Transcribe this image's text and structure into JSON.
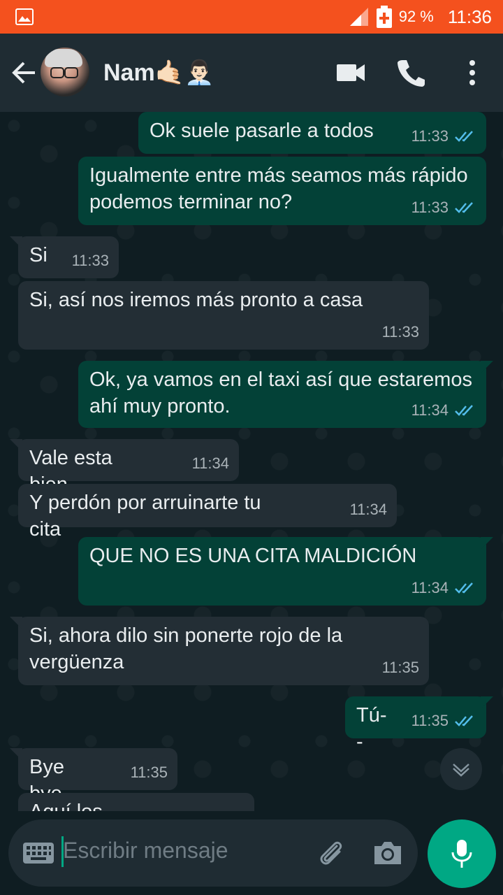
{
  "status": {
    "battery_pct": "92 %",
    "time": "11:36"
  },
  "header": {
    "name": "Nam🤙🏻👨🏻‍💼"
  },
  "messages": [
    {
      "dir": "out",
      "text": "Ok suele pasarle a todos",
      "time": "11:33"
    },
    {
      "dir": "out",
      "text": "Igualmente entre más seamos más rápido podemos terminar no?",
      "time": "11:33"
    },
    {
      "dir": "in",
      "text": "Si",
      "time": "11:33"
    },
    {
      "dir": "in",
      "text": "Si, así nos iremos más pronto a casa",
      "time": "11:33"
    },
    {
      "dir": "out",
      "text": "Ok, ya vamos en el taxi así que estaremos ahí muy pronto.",
      "time": "11:34"
    },
    {
      "dir": "in",
      "text": "Vale esta bien",
      "time": "11:34"
    },
    {
      "dir": "in",
      "text": "Y perdón por arruinarte tu cita",
      "time": "11:34"
    },
    {
      "dir": "out",
      "text": "QUE NO ES UNA CITA MALDICIÓN",
      "time": "11:34"
    },
    {
      "dir": "in",
      "text": "Si, ahora dilo sin ponerte rojo de la vergüenza",
      "time": "11:35"
    },
    {
      "dir": "out",
      "text": "Tú--",
      "time": "11:35"
    },
    {
      "dir": "in",
      "text": "Bye bye",
      "time": "11:35"
    },
    {
      "dir": "in",
      "text": "Aquí los espero",
      "time": ""
    }
  ],
  "input": {
    "placeholder": "Escribir mensaje"
  },
  "colors": {
    "statusbar": "#f4511e",
    "header": "#1f2c33",
    "outgoing": "#034137",
    "incoming": "#232e35",
    "accent": "#00a884",
    "read_tick": "#53bdeb"
  }
}
